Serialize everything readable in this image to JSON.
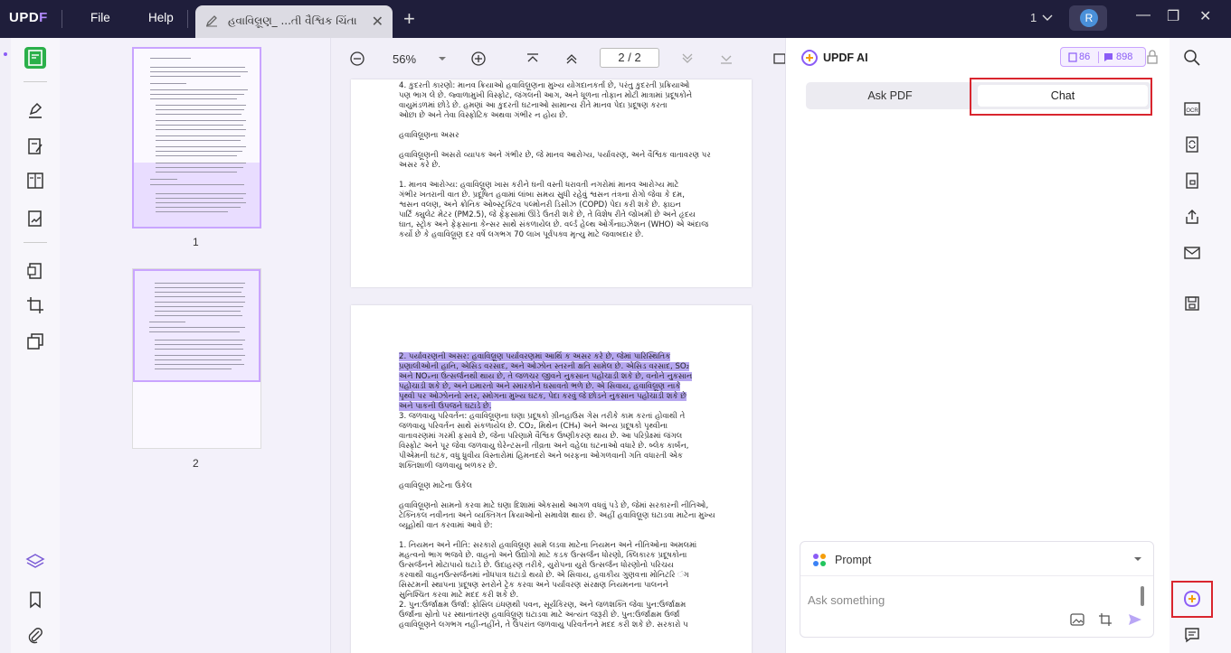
{
  "titlebar": {
    "logo_up": "UPD",
    "logo_f": "F",
    "menu_file": "File",
    "menu_help": "Help",
    "tab_title": "હવાવિલ્રૂણ_ ...તી વૈશ્વિક ચિંતા",
    "tab_close": "✕",
    "new_tab": "+",
    "count": "1",
    "avatar_letter": "R",
    "minimize": "—",
    "maximize": "❐",
    "close": "✕"
  },
  "thumbnails": {
    "pages": [
      {
        "number": "1"
      },
      {
        "number": "2"
      }
    ]
  },
  "doc_toolbar": {
    "zoom": "56%",
    "page_current": "2",
    "page_sep": "/",
    "page_total": "2"
  },
  "page1": {
    "lines": [
      "4.  કુદરતી કારણો: માનવ ક્રિયાઓ હવાવિલ્રૂણના મુખ્ય યોગદાનકર્તા છે, પરંતુ કુદરતી પ્રક્રિયાઓ",
      "     પણ ભાગ લે છે. જ્વાળામુખી વિસ્ફોટ, જંગલની આગ, અને ધૂળના તોફાન મોટી માત્રામાં પ્રદૂષકોને",
      "     વાયુમંડળમાં છોડે છે. હમણાં આ કુદરતી ઘટનાઓ સામાન્ય રીતે માનવ પેદા પ્રદૂષણ કરતા",
      "     ઓછા છે અને તેવા વિસ્ફોટિક અથવા ગંભીર ન હોય છે.",
      "",
      "હવાવિલ્રૂણના અસર",
      "",
      "હવાવિલ્રૂણની અસરો વ્યાપક અને ગંભીર છે, જે માનવ આરોગ્ય, પર્યાવરણ, અને વૈશ્વિક વાતાવરણ પર",
      "અસર કરે છે.",
      "",
      "1.  માનવ આરોગ્ય: હવાવિલ્રૂણ ખાસ કરીને ઘની વસ્તી ધરાવતી નગરોમાં માનવ આરોગ્ય માટે",
      "     ગંભીર ખતરાની વાત છે. પ્રદૂષિત હવામાં લાંબા સમય સુધી રહેવું શ્વસન તંત્રના રોગો જેવા કે દમ,",
      "     શ્વસન વલણ, અને ક્રોનિક ઓબ્સ્ટ્રક્ટિવ પલ્મોનરી ડિસીઝ (COPD) પેદા કરી શકે છે. ફાઇન",
      "     પાર્ટિ  ક્યુલેટ મેટર (PM2.5), જે ફેફસામાં ઊંડે ઉતરી શકે છે, તે વિશેષ રીતે જોખમી છે અને હૃદય",
      "     ઘાત, સ્ટ્રોક અને ફેફસાના કેન્સર સાથે સંકળાયેલ છે. વર્લ્ડ હેલ્થ ઓર્ગેનાઇઝેશન (WHO) એ અંદાજ",
      "     કર્યો છે કે હવાવિલ્રૂણ દર વર્ષે લગભગ 70 લાખ પૂર્વપક્વ મૃત્યુ માટે જવાબદાર છે."
    ]
  },
  "page2": {
    "highlight_lines": [
      "2.  પર્યાવરણની અસર: હવાવિલ્રૂણ પર્યાવરણમાં આર્થિ  ક અસર કરે છે, જેમાં પારિસ્થિતિક",
      "     પ્રણાલીઓની હાનિ, એસિડ વરસાદ, અને ઓઝોન સ્તરની ક્ષતિ સામેલ છે. એસિડ વરસાદ, SO₂",
      "     અને NOₓના ઉત્સર્જનથી થાય છે, તે જળચર જીવને નુકસાન પહોંચાડી શકે છે, વનોને નુકસાન",
      "     પહોંચાડી શકે છે, અને ઇમારતો અને સ્મારકોને ઘસાવતો ભળે છે. એ સિવાય, હવાવિલ્રૂણ નાકે",
      "     પૃથ્વી પર ઓઝોનનો સ્તર, સ્મોગના મુખ્ય ઘટક, પેદા કરવું જે છોડને નુકસાન પહોંચાડી શકે છે",
      "     અને પાકની ઉપજને ઘટાડે છે."
    ],
    "lines": [
      "3.  જળવાયુ પરિવર્તન: હવાવિલ્રૂણના ઘણા પ્રદૂષકો ગ્રીનહાઉસ ગેસ તરીકે કામ કરતાં હોવાથી તે",
      "     જળવાયુ પરિવર્તન સાથે સંકળાયેલ છે. CO₂, મિથેન (CH₄) અને અન્ય પ્રદૂષકો પૃથ્વીના",
      "     વાતાવરણમાં ગરમી ફસાવે છે, જેના પરિણામે વૈશ્વિક ઉષ્ણીકરણ થાય છે. આ પરિપ્રેક્ષ્માં જંગલ",
      "     વિસ્ફોટ અને પૂર જેવા જળવાયુ ઘેરેન્ટસની તીવ્રતા અને વહેલા ઘટનાઓ વધારે છે. બ્લેક કાર્બન,",
      "     પીએમની ઘટક, વધુ ધ્રુવીય વિસ્તારોમાં હિમનદરો અને બરફના ઓગળવાની ગતિ વધારતી એક",
      "     શક્તિશાળી જળવાયુ બળકર છે.",
      "",
      "હવાવિલ્રૂણ માટેના ઉકેલ",
      "",
      "હવાવિલ્રૂણનો સામનો કરવા માટે ઘણા દિશામાં એકસાથે આગળ વધવું પડે છે, જેમાં સરકારની નીતિઓ,",
      "ટેક્નિકલ નવીનતા અને વ્યક્તિગત ક્રિયાઓનો સમાવેશ થાય છે. અહીં હવાવિલ્રૂણ ઘટાડવા માટેના મુખ્ય",
      "વ્યૂહોથી વાત કરવામાં આવે છે:",
      "",
      "1.  નિયમન અને નીતિ: સરકારો હવાવિલ્રૂણ સામે લડવા માટેના નિયમન અને નીતિઓના અમલમાં",
      "     મહત્વનો ભાગ ભજવે છે. વાહનો અને ઉદ્યોગો માટે કડક ઉત્સર્જન ધોરણો, ક્લિકારક પ્રદૂષકોના",
      "     ઉત્સર્જનને મોટાપાયે ઘટાડે છે. ઉદાહરણ તરીકે, યુરોપના યુરો ઉત્સર્જન ધોરણોનો પરિચય",
      "     કરવાથી વાહનઉત્સર્જનમાં નોંધપાત્ર ઘટાડો થયો છે. એ સિવાય, હવાકીય ગુણવત્તા મોનિટરિ   ંગ",
      "     સિસ્ટમની સ્થાપના પ્રદૂષણ સ્તરોને ટ્રેક કરવા અને પર્યાવરણ સંરક્ષણ નિયમનના પાલનને",
      "     સુનિશ્ચિત કરવા માટે મદદ કરી શકે છે.",
      "2.  પુન:ઉર્જાક્ષમ ઉર્જા: ફોસિલ ઇંધણથી પવન, સૂર્યકિરણ, અને જળશક્તિ જેવા પુન:ઉર્જાક્ષમ",
      "     ઉર્જાના સ્રોતો પર સ્થાનાંતરણ હવાવિલ્રૂણ ઘટાડવા માટે અત્યંત જરૂરી છે. પુન:ઉર્જાક્ષમ ઉર્જા",
      "     હવાવિલ્રૂણને લગભગ નહીં-નહીંને, તે ઉપરાંત જળવાયુ પરિવર્તનને મદદ કરી શકે છે. સરકારો પ"
    ]
  },
  "ai_panel": {
    "title": "UPDF AI",
    "credits_a": "86",
    "credits_b": "898",
    "tab_ask_pdf": "Ask PDF",
    "tab_chat": "Chat",
    "prompt_label": "Prompt",
    "ask_placeholder": "Ask something",
    "accent": "#8b5cf6",
    "annotation_color": "#d9252e"
  }
}
